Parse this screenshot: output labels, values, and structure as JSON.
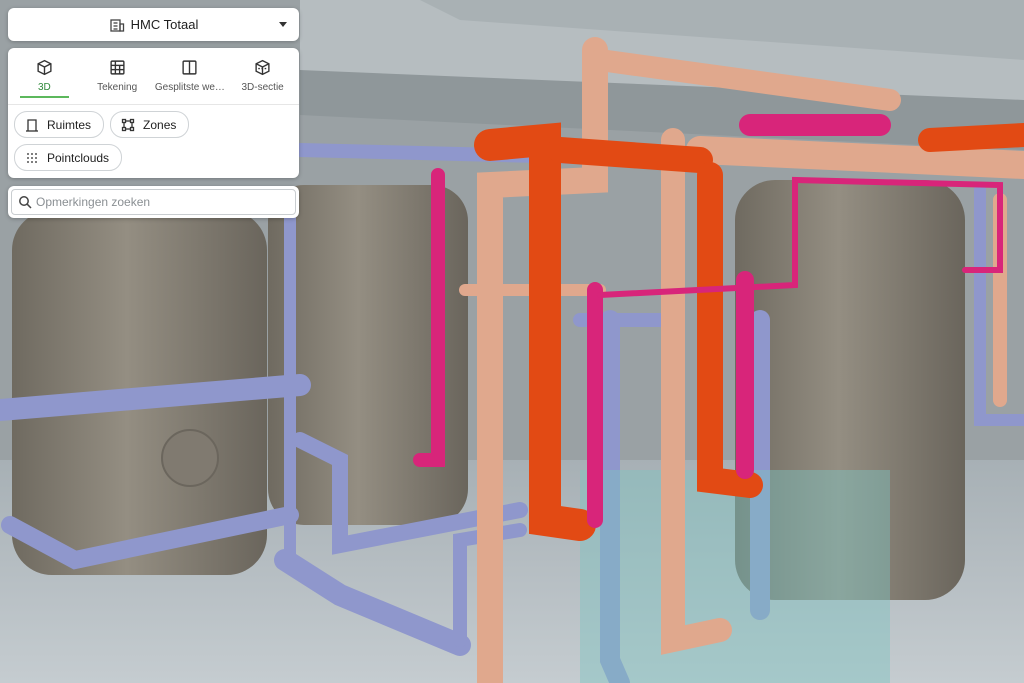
{
  "model_selector": {
    "title": "HMC Totaal",
    "icon": "building-icon"
  },
  "view_tabs": [
    {
      "label": "3D",
      "icon": "cube-icon",
      "active": true
    },
    {
      "label": "Tekening",
      "icon": "blueprint-icon",
      "active": false
    },
    {
      "label": "Gesplitste we…",
      "icon": "split-view-icon",
      "active": false
    },
    {
      "label": "3D-sectie",
      "icon": "cube-section-icon",
      "active": false
    }
  ],
  "filters": {
    "rooms": {
      "label": "Ruimtes",
      "icon": "room-icon"
    },
    "zones": {
      "label": "Zones",
      "icon": "zones-icon"
    },
    "pointclouds": {
      "label": "Pointclouds",
      "icon": "pointcloud-icon"
    }
  },
  "search": {
    "placeholder": "Opmerkingen zoeken",
    "value": ""
  },
  "colors": {
    "accent": "#5cb85c",
    "pipe_blue": "#8f97cc",
    "pipe_orange": "#e24a14",
    "pipe_magenta": "#d8257a",
    "pipe_salmon": "#e0a88d",
    "tank": "#8a8478"
  }
}
